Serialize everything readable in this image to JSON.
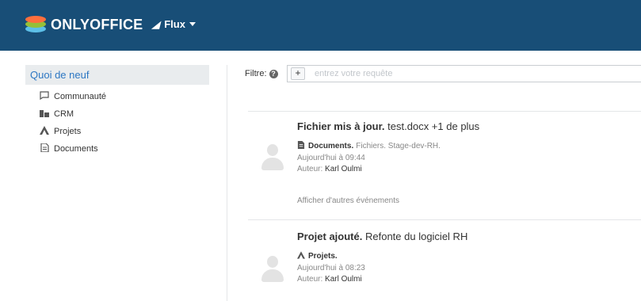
{
  "header": {
    "logo_text": "ONLYOFFICE",
    "module_label": "Flux",
    "bg_color": "#184e77"
  },
  "sidebar": {
    "active_label": "Quoi de neuf",
    "items": [
      {
        "label": "Communauté",
        "icon": "chat-icon"
      },
      {
        "label": "CRM",
        "icon": "crm-icon"
      },
      {
        "label": "Projets",
        "icon": "projects-icon"
      },
      {
        "label": "Documents",
        "icon": "document-icon"
      }
    ]
  },
  "filter": {
    "label": "Filtre:",
    "add_label": "+",
    "placeholder": "entrez votre requête"
  },
  "events": [
    {
      "action": "Fichier mis à jour.",
      "object": "test.docx +1 de plus",
      "module": "Documents.",
      "module_detail": "Fichiers. Stage-dev-RH.",
      "date": "Aujourd'hui à 09:44",
      "author_label": "Auteur:",
      "author": "Karl Oulmi",
      "more": "Afficher d'autres événements"
    },
    {
      "action": "Projet ajouté.",
      "object": "Refonte du logiciel RH",
      "module": "Projets.",
      "module_detail": "",
      "date": "Aujourd'hui à 08:23",
      "author_label": "Auteur:",
      "author": "Karl Oulmi"
    }
  ]
}
